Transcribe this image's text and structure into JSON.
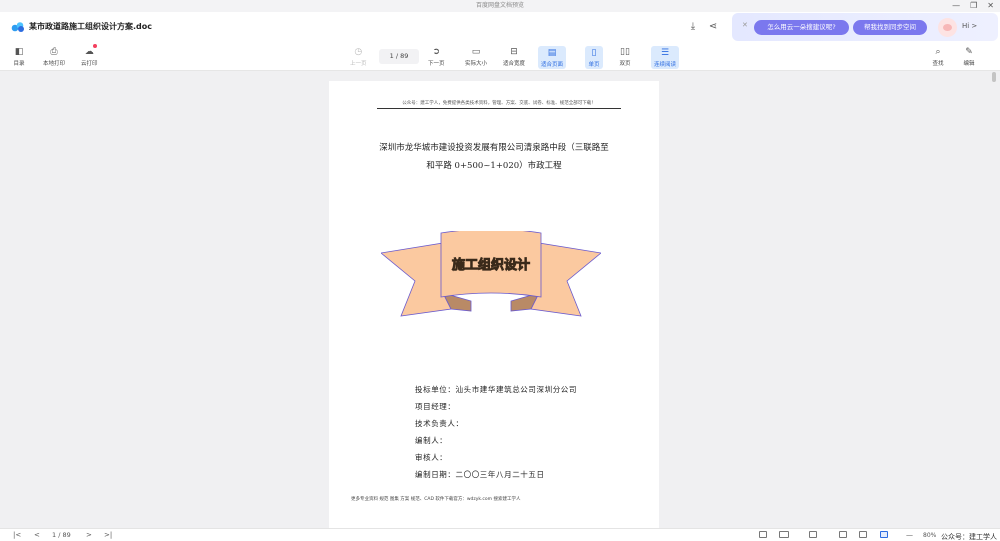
{
  "window": {
    "title": "百度网盘文档预览"
  },
  "doc": {
    "title": "某市政道路施工组织设计方案.doc"
  },
  "banner": {
    "pill1": "怎么用云一朵搜建议呢?",
    "pill2": "帮我找到同步空间",
    "hi": "Hi >"
  },
  "toolbar": {
    "toc": "目录",
    "local_print": "本地打印",
    "cloud_print": "云打印",
    "prev": "上一页",
    "page_indicator": "1 / 89",
    "next": "下一页",
    "actual_size": "实际大小",
    "fit_width": "适合宽度",
    "fit_page": "适合页面",
    "single_page": "单页",
    "double_page": "双页",
    "continuous": "连续阅读",
    "find": "查找",
    "edit": "编辑"
  },
  "page": {
    "header": "公众号：建工学人，免费提供各类技术资料，管理、方案、交底、试卷、标准、规范全部可下载！",
    "title_line1": "深圳市龙华城市建设投资发展有限公司清泉路中段（三联路至",
    "title_line2": "和平路 0+500~1+020）市政工程",
    "banner_text": "施工组织设计",
    "fields": [
      "投标单位：汕头市建华建筑总公司深圳分公司",
      "项目经理：",
      "技术负责人：",
      "编制人：",
      "审核人：",
      "编制日期：二〇〇三年八月二十五日"
    ],
    "footer": "更多专业资料 规范 图集 方案 规范、CAD 软件下载官方：wdzyk.com 搜索建工学人"
  },
  "bottombar": {
    "page_indicator": "1 / 89",
    "zoom": "80%",
    "watermark": "公众号：建工学人"
  },
  "colors": {
    "accent": "#2d6ce0",
    "banner_pill": "#7b78ee",
    "ribbon_fill": "#fbc9a0",
    "ribbon_stroke": "#6a5acd"
  }
}
